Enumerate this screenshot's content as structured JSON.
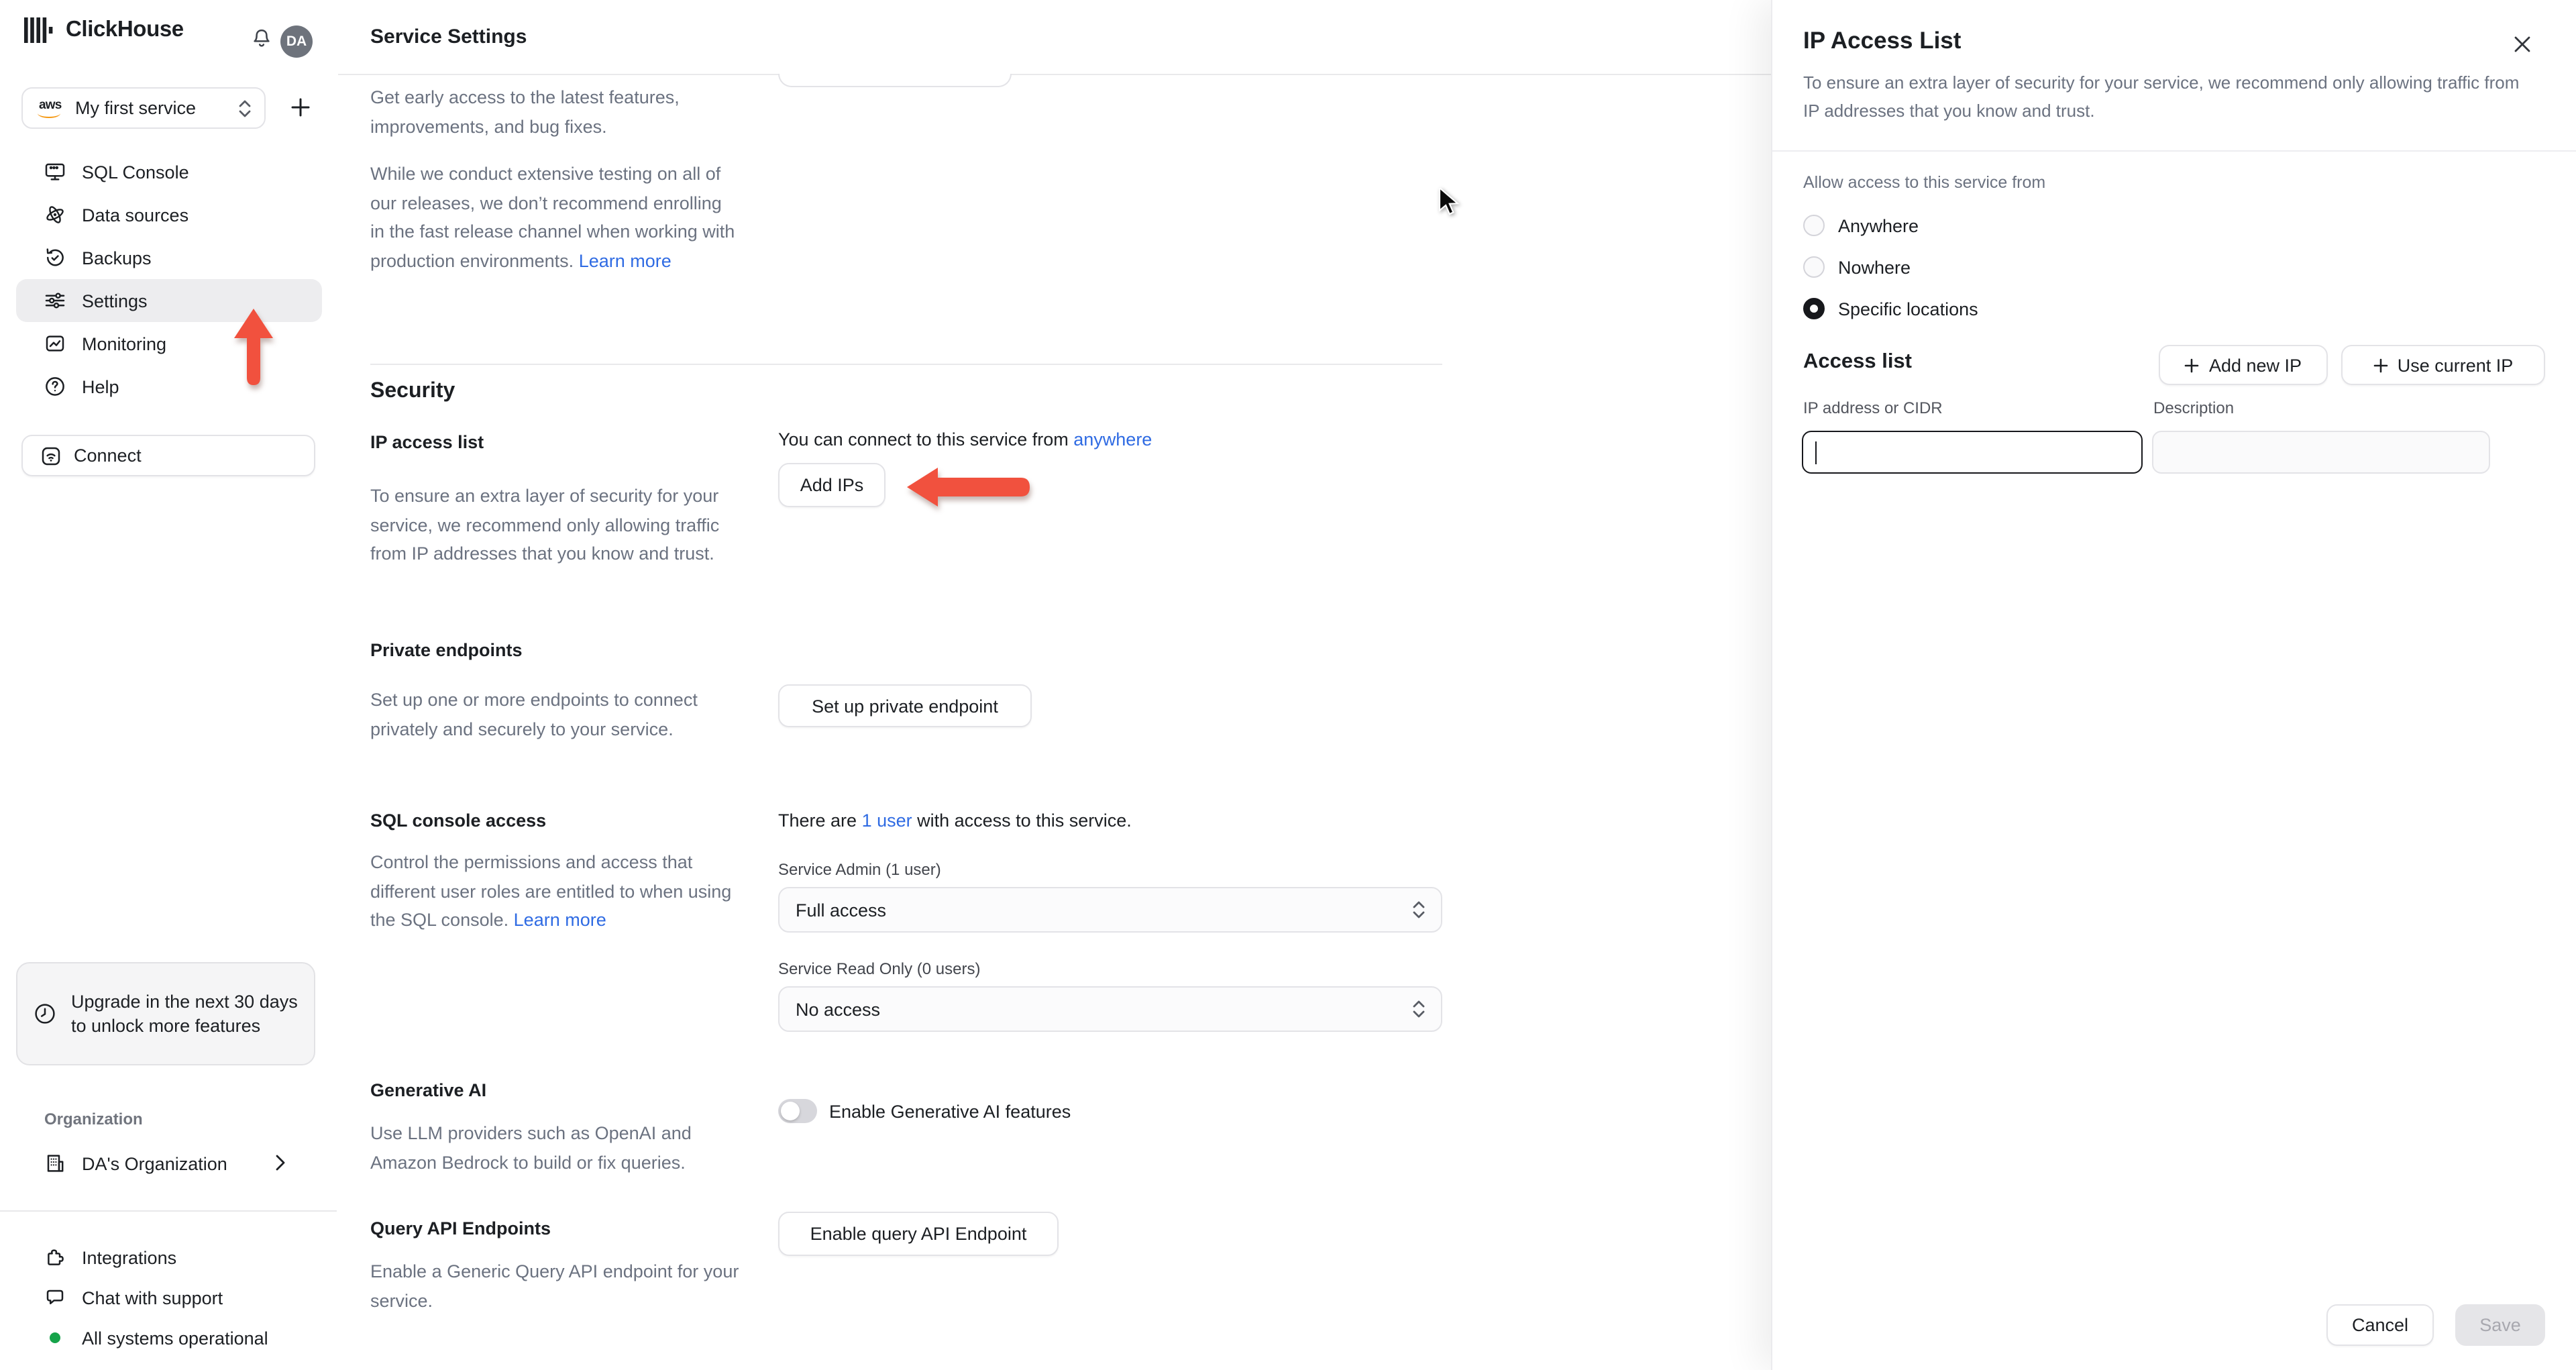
{
  "topbar": {
    "brand": "ClickHouse",
    "avatar_initials": "DA"
  },
  "sidebar": {
    "service_selector": {
      "provider": "aws",
      "label": "My first service"
    },
    "nav": [
      {
        "label": "SQL Console",
        "active": false
      },
      {
        "label": "Data sources",
        "active": false
      },
      {
        "label": "Backups",
        "active": false
      },
      {
        "label": "Settings",
        "active": true
      },
      {
        "label": "Monitoring",
        "active": false
      },
      {
        "label": "Help",
        "active": false
      }
    ],
    "connect_label": "Connect",
    "upgrade_notice": "Upgrade in the next 30 days to unlock more features",
    "organization_label": "Organization",
    "organization_name": "DA's Organization",
    "integrations_label": "Integrations",
    "chat_label": "Chat with support",
    "status_label": "All systems operational"
  },
  "main": {
    "title": "Service Settings",
    "release_channel": {
      "p1": "Get early access to the latest features, improvements, and bug fixes.",
      "p2": "While we conduct extensive testing on all of our releases, we don’t recommend enrolling in the fast release channel when working with production environments. ",
      "learn_more": "Learn more"
    },
    "security": {
      "heading": "Security",
      "ip_access": {
        "label": "IP access list",
        "description": "To ensure an extra layer of security for your service, we recommend only allowing traffic from IP addresses that you know and trust.",
        "status_prefix": "You can connect to this service from ",
        "status_link": "anywhere",
        "button": "Add IPs"
      },
      "private_endpoints": {
        "label": "Private endpoints",
        "description": "Set up one or more endpoints to connect privately and securely to your service.",
        "button": "Set up private endpoint"
      },
      "sql_console_access": {
        "label": "SQL console access",
        "description": "Control the permissions and access that different user roles are entitled to when using the SQL console. ",
        "learn_more": "Learn more",
        "status_prefix": "There are ",
        "status_link": "1 user",
        "status_suffix": " with access to this service.",
        "admin_label": "Service Admin (1 user)",
        "admin_value": "Full access",
        "readonly_label": "Service Read Only (0 users)",
        "readonly_value": "No access"
      },
      "generative_ai": {
        "label": "Generative AI",
        "description": "Use LLM providers such as OpenAI and Amazon Bedrock to build or fix queries.",
        "toggle_label": "Enable Generative AI features",
        "toggle_on": false
      },
      "query_api": {
        "label": "Query API Endpoints",
        "description": "Enable a Generic Query API endpoint for your service.",
        "button": "Enable query API Endpoint"
      }
    }
  },
  "drawer": {
    "title": "IP Access List",
    "description": "To ensure an extra layer of security for your service, we recommend only allowing traffic from IP addresses that you know and trust.",
    "allow_label": "Allow access to this service from",
    "options": [
      {
        "label": "Anywhere",
        "selected": false
      },
      {
        "label": "Nowhere",
        "selected": false
      },
      {
        "label": "Specific locations",
        "selected": true
      }
    ],
    "access_list": {
      "heading": "Access list",
      "add_new_ip": "Add new IP",
      "use_current_ip": "Use current IP",
      "ip_label": "IP address or CIDR",
      "ip_value": "",
      "desc_label": "Description",
      "desc_value": ""
    },
    "footer": {
      "cancel": "Cancel",
      "save": "Save"
    }
  },
  "colors": {
    "link": "#2f6be3",
    "arrow_accent": "#f1513e",
    "status_ok": "#16a34a",
    "avatar_bg": "#6e737c"
  }
}
